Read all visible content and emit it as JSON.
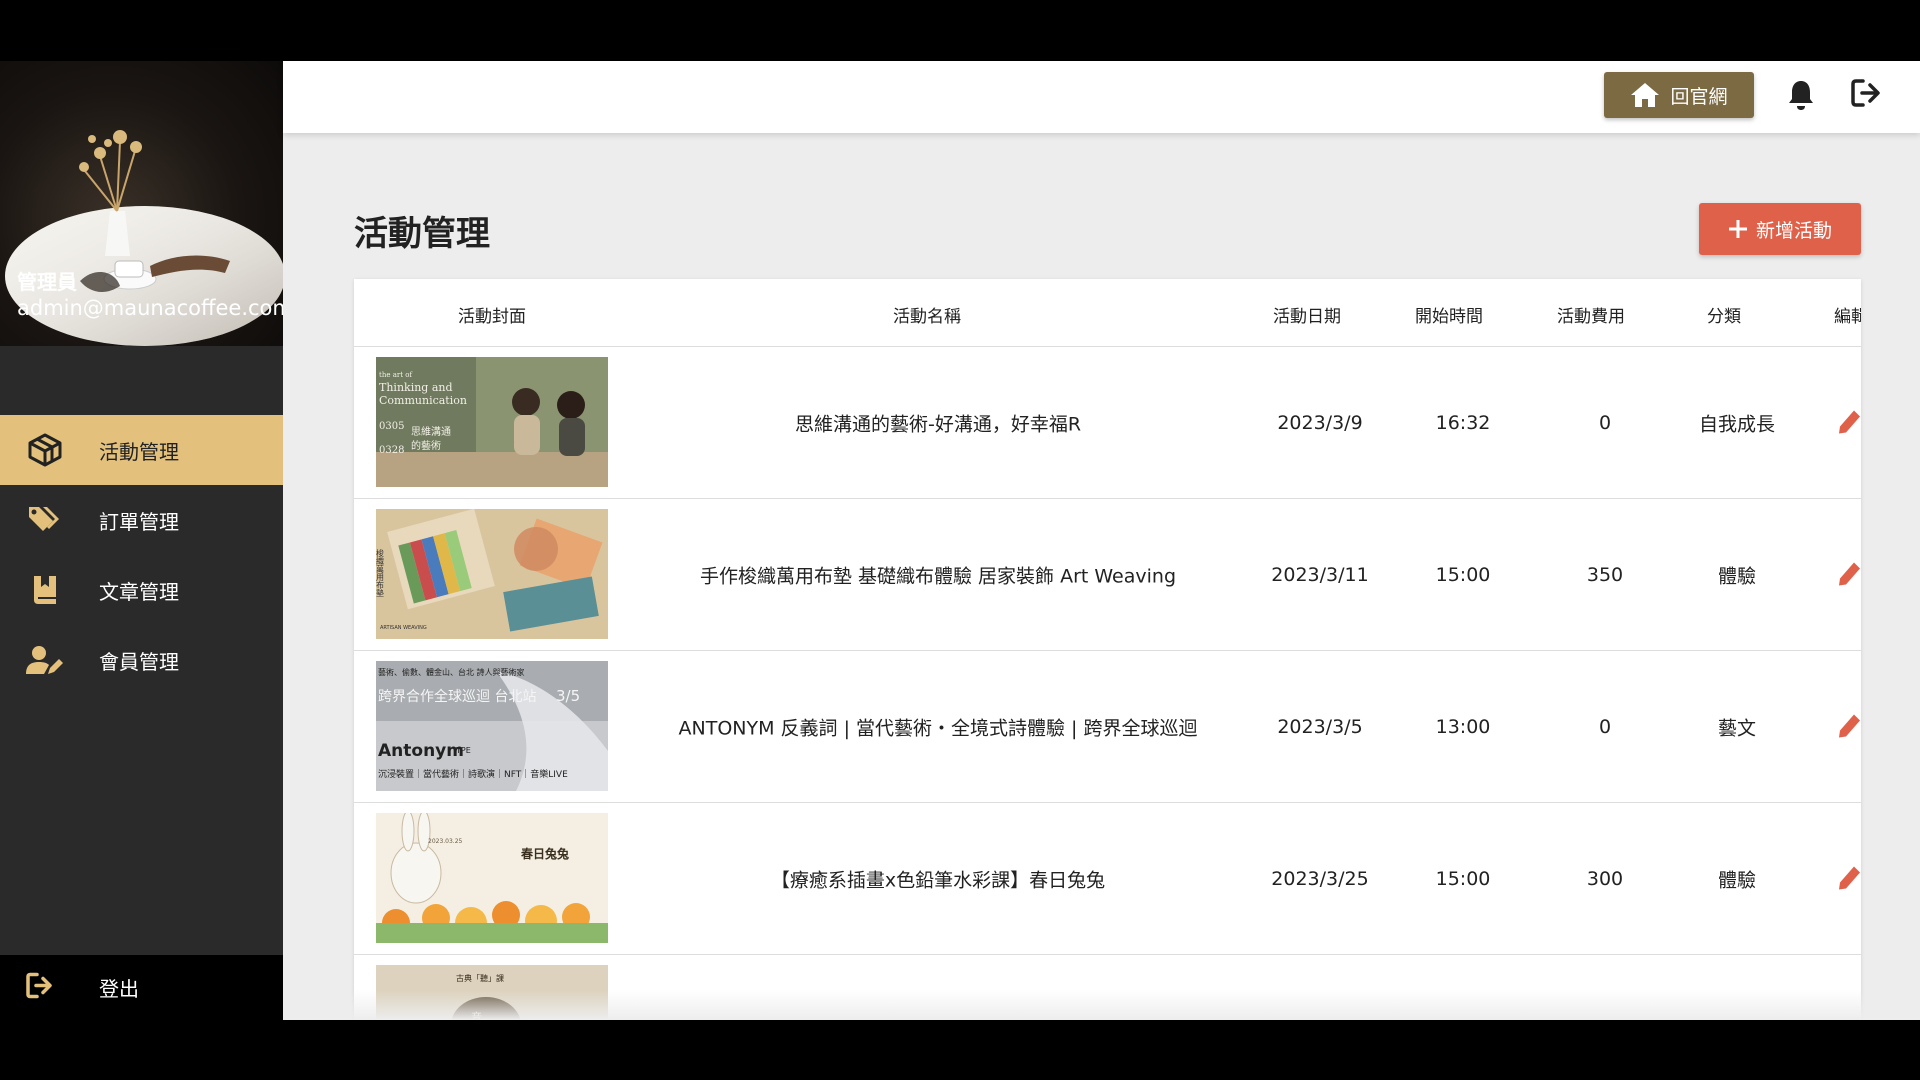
{
  "sidebar": {
    "profile": {
      "role": "管理員",
      "email": "admin@maunacoffee.com"
    },
    "items": [
      {
        "label": "活動管理",
        "icon": "cube-icon",
        "active": true
      },
      {
        "label": "訂單管理",
        "icon": "tags-icon",
        "active": false
      },
      {
        "label": "文章管理",
        "icon": "book-icon",
        "active": false
      },
      {
        "label": "會員管理",
        "icon": "user-edit-icon",
        "active": false
      }
    ],
    "logout_label": "登出"
  },
  "topbar": {
    "home_label": "回官網",
    "bell_icon": "bell-icon",
    "exit_icon": "sign-out-icon"
  },
  "main": {
    "title": "活動管理",
    "add_label": "新增活動"
  },
  "table": {
    "headers": {
      "cover": "活動封面",
      "name": "活動名稱",
      "date": "活動日期",
      "start": "開始時間",
      "fee": "活動費用",
      "category": "分類",
      "edit": "編輯"
    },
    "rows": [
      {
        "name": "思維溝通的藝術-好溝通，好幸福R",
        "date": "2023/3/9",
        "start": "16:32",
        "fee": "0",
        "category": "自我成長",
        "cover": {
          "lines": [
            "the art of",
            "Thinking and",
            "Communication",
            "0305",
            "思維溝通",
            "0328",
            "的藝術"
          ]
        }
      },
      {
        "name": "手作梭織萬用布墊 基礎織布體驗 居家裝飾 Art Weaving",
        "date": "2023/3/11",
        "start": "15:00",
        "fee": "350",
        "category": "體驗",
        "cover": {
          "lines": [
            "梭織萬用布墊",
            "ARTISAN WEAVING"
          ]
        }
      },
      {
        "name": "ANTONYM 反義詞 | 當代藝術・全境式詩體驗 | 跨界全球巡迴",
        "date": "2023/3/5",
        "start": "13:00",
        "fee": "0",
        "category": "藝文",
        "cover": {
          "lines": [
            "藝術、偷數、體金山、台北 詩人與藝術家",
            "跨界合作全球巡迴 台北站",
            "3/5",
            "Antonym",
            "TPE",
            "沉浸裝置｜當代藝術｜詩歌演｜NFT｜音樂LIVE"
          ]
        }
      },
      {
        "name": "【療癒系插畫x色鉛筆水彩課】春日兔兔",
        "date": "2023/3/25",
        "start": "15:00",
        "fee": "300",
        "category": "體驗",
        "cover": {
          "lines": [
            "春日兔兔",
            "2023.03.25"
          ]
        }
      },
      {
        "name": "",
        "date": "",
        "start": "",
        "fee": "",
        "category": "",
        "cover": {
          "lines": [
            "古典「聽」課",
            "音"
          ]
        }
      }
    ]
  },
  "colors": {
    "sidebar_bg": "#2a2a2a",
    "active_item": "#e3c17c",
    "home_button": "#7c6a43",
    "add_button": "#e0614a",
    "edit_icon": "#e0614a"
  }
}
